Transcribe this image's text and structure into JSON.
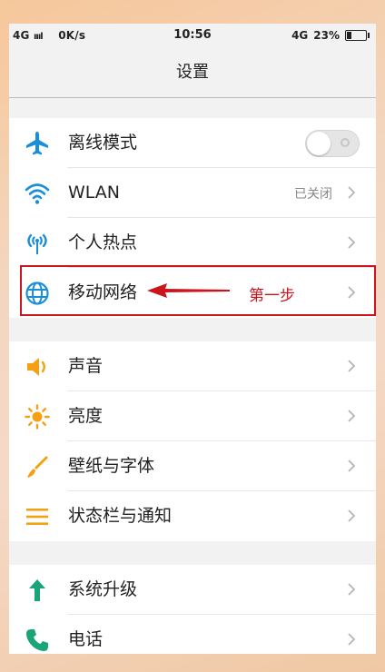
{
  "status_bar": {
    "network": "4G",
    "speed": "0K/s",
    "time": "10:56",
    "network_right": "4G",
    "battery": "23%",
    "battery_level": 0.23
  },
  "title": "设置",
  "groups": [
    [
      {
        "label": "离线模式",
        "icon": "airplane-icon",
        "toggle": "off"
      },
      {
        "label": "WLAN",
        "icon": "wifi-icon",
        "value": "已关闭"
      },
      {
        "label": "个人热点",
        "icon": "hotspot-icon"
      },
      {
        "label": "移动网络",
        "icon": "globe-icon"
      }
    ],
    [
      {
        "label": "声音",
        "icon": "speaker-icon"
      },
      {
        "label": "亮度",
        "icon": "sun-icon"
      },
      {
        "label": "壁纸与字体",
        "icon": "brush-icon"
      },
      {
        "label": "状态栏与通知",
        "icon": "menu-lines-icon"
      }
    ],
    [
      {
        "label": "系统升级",
        "icon": "up-arrow-icon"
      },
      {
        "label": "电话",
        "icon": "phone-icon"
      }
    ]
  ],
  "annotation": {
    "text": "第一步",
    "color": "#c9151b"
  },
  "colors": {
    "icon_blue": "#1a8fd8",
    "icon_orange": "#f5a012",
    "icon_green": "#1aa578",
    "annotation_red": "#c9151b"
  }
}
